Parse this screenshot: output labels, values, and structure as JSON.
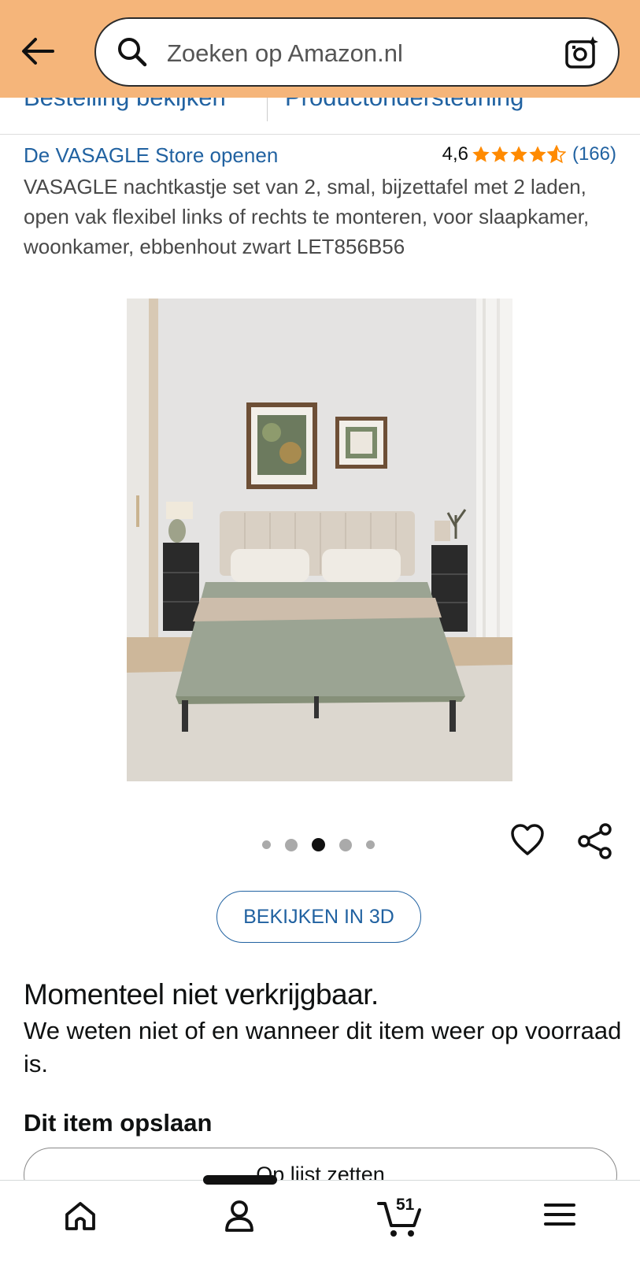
{
  "header": {
    "search_placeholder": "Zoeken op Amazon.nl",
    "bg_color": "#f5b57a"
  },
  "subnav": {
    "link_order": "Bestelling bekijken",
    "link_support": "Productondersteuning"
  },
  "product": {
    "store_link": "De VASAGLE Store openen",
    "rating_value": "4,6",
    "rating_stars": 4.6,
    "review_count": "(166)",
    "title": "VASAGLE nachtkastje set van 2, smal, bijzettafel met 2 laden, open vak flexibel links of rechts te monteren, voor slaapkamer, woonkamer, ebbenhout zwart LET856B56"
  },
  "gallery": {
    "total_images": 5,
    "active_index": 2
  },
  "actions": {
    "view_3d": "BEKIJKEN IN 3D"
  },
  "availability": {
    "heading": "Momenteel niet verkrijgbaar.",
    "text": "We weten niet of en wanneer dit item weer op voorraad is."
  },
  "save": {
    "heading": "Dit item opslaan",
    "add_to_list": "Op lijst zetten"
  },
  "bottom_nav": {
    "items": [
      "home-icon",
      "account-icon",
      "cart-icon",
      "menu-icon"
    ],
    "cart_count": "51"
  },
  "colors": {
    "link": "#2162a1",
    "star": "#ff8a00"
  }
}
